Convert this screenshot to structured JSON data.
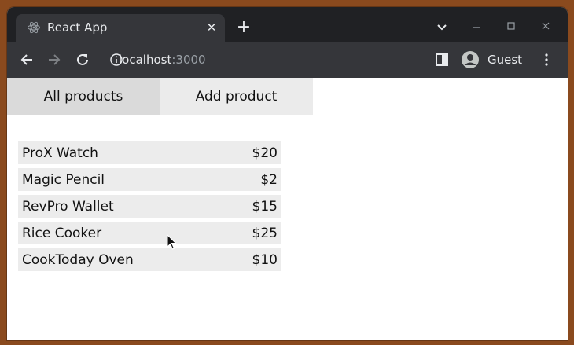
{
  "browser": {
    "tab_title": "React App",
    "url_host": "localhost",
    "url_port": ":3000",
    "profile_label": "Guest",
    "icons": {
      "favicon": "react-icon",
      "close": "close-icon",
      "new_tab": "plus-icon",
      "tab_search": "chevron-down-icon",
      "minimize": "minimize-icon",
      "maximize": "maximize-icon",
      "window_close": "close-icon",
      "back": "back-arrow-icon",
      "forward": "forward-arrow-icon",
      "reload": "reload-icon",
      "site_info": "info-icon",
      "side_panel": "side-panel-icon",
      "profile": "avatar-icon",
      "menu": "kebab-menu-icon"
    }
  },
  "nav": {
    "all_products_label": "All products",
    "add_product_label": "Add product"
  },
  "products": [
    {
      "name": "ProX Watch",
      "price": "$20"
    },
    {
      "name": "Magic Pencil",
      "price": "$2"
    },
    {
      "name": "RevPro Wallet",
      "price": "$15"
    },
    {
      "name": "Rice Cooker",
      "price": "$25"
    },
    {
      "name": "CookToday Oven",
      "price": "$10"
    }
  ],
  "colors": {
    "desktop": "#8a4a1e",
    "tabstrip": "#202124",
    "toolbar": "#35363a",
    "nav_active": "#dadada",
    "nav_inactive": "#ebebeb",
    "row_bg": "#ececec"
  }
}
